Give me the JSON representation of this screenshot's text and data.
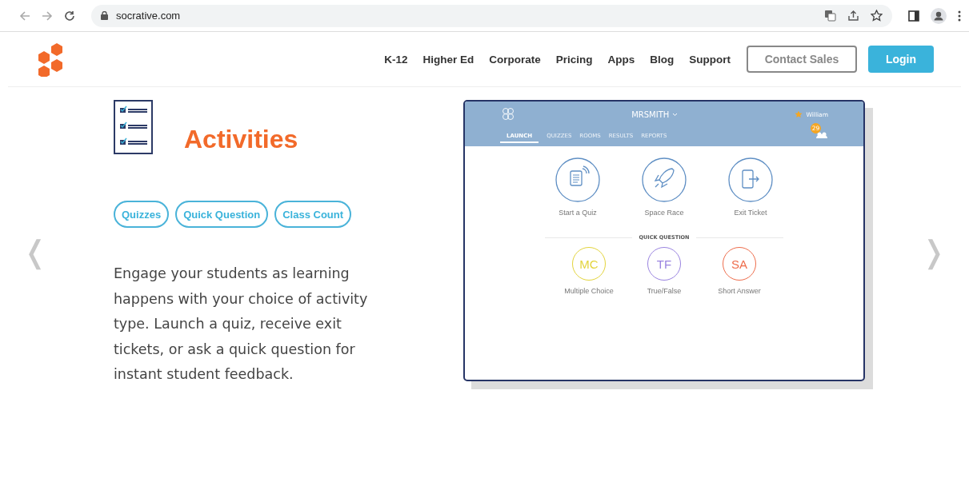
{
  "browser": {
    "url": "socrative.com"
  },
  "nav": {
    "links": [
      "K-12",
      "Higher Ed",
      "Corporate",
      "Pricing",
      "Apps",
      "Blog",
      "Support"
    ],
    "contact": "Contact Sales",
    "login": "Login"
  },
  "feature": {
    "title": "Activities",
    "tags": [
      "Quizzes",
      "Quick Question",
      "Class Count"
    ],
    "description": "Engage your students as learning happens with your choice of activity type. Launch a quiz, receive exit tickets, or ask a quick question for instant student feedback."
  },
  "app": {
    "room": "MRSMITH",
    "user": "William",
    "count": "29",
    "tabs": [
      {
        "label": "LAUNCH",
        "selected": true
      },
      {
        "label": "QUIZZES",
        "selected": false
      },
      {
        "label": "ROOMS",
        "selected": false
      },
      {
        "label": "RESULTS",
        "selected": false
      },
      {
        "label": "REPORTS",
        "selected": false
      }
    ],
    "activities": [
      {
        "kind": "quiz",
        "label": "Start a Quiz"
      },
      {
        "kind": "rocket",
        "label": "Space Race"
      },
      {
        "kind": "exit",
        "label": "Exit Ticket"
      }
    ],
    "section": "QUICK QUESTION",
    "questions": [
      {
        "abbr": "MC",
        "label": "Multiple Choice",
        "color": "#e3d43c"
      },
      {
        "abbr": "TF",
        "label": "True/False",
        "color": "#9a84e0"
      },
      {
        "abbr": "SA",
        "label": "Short Answer",
        "color": "#ee6d4c"
      }
    ]
  },
  "carousel": {
    "prev": "❬",
    "next": "❭"
  }
}
